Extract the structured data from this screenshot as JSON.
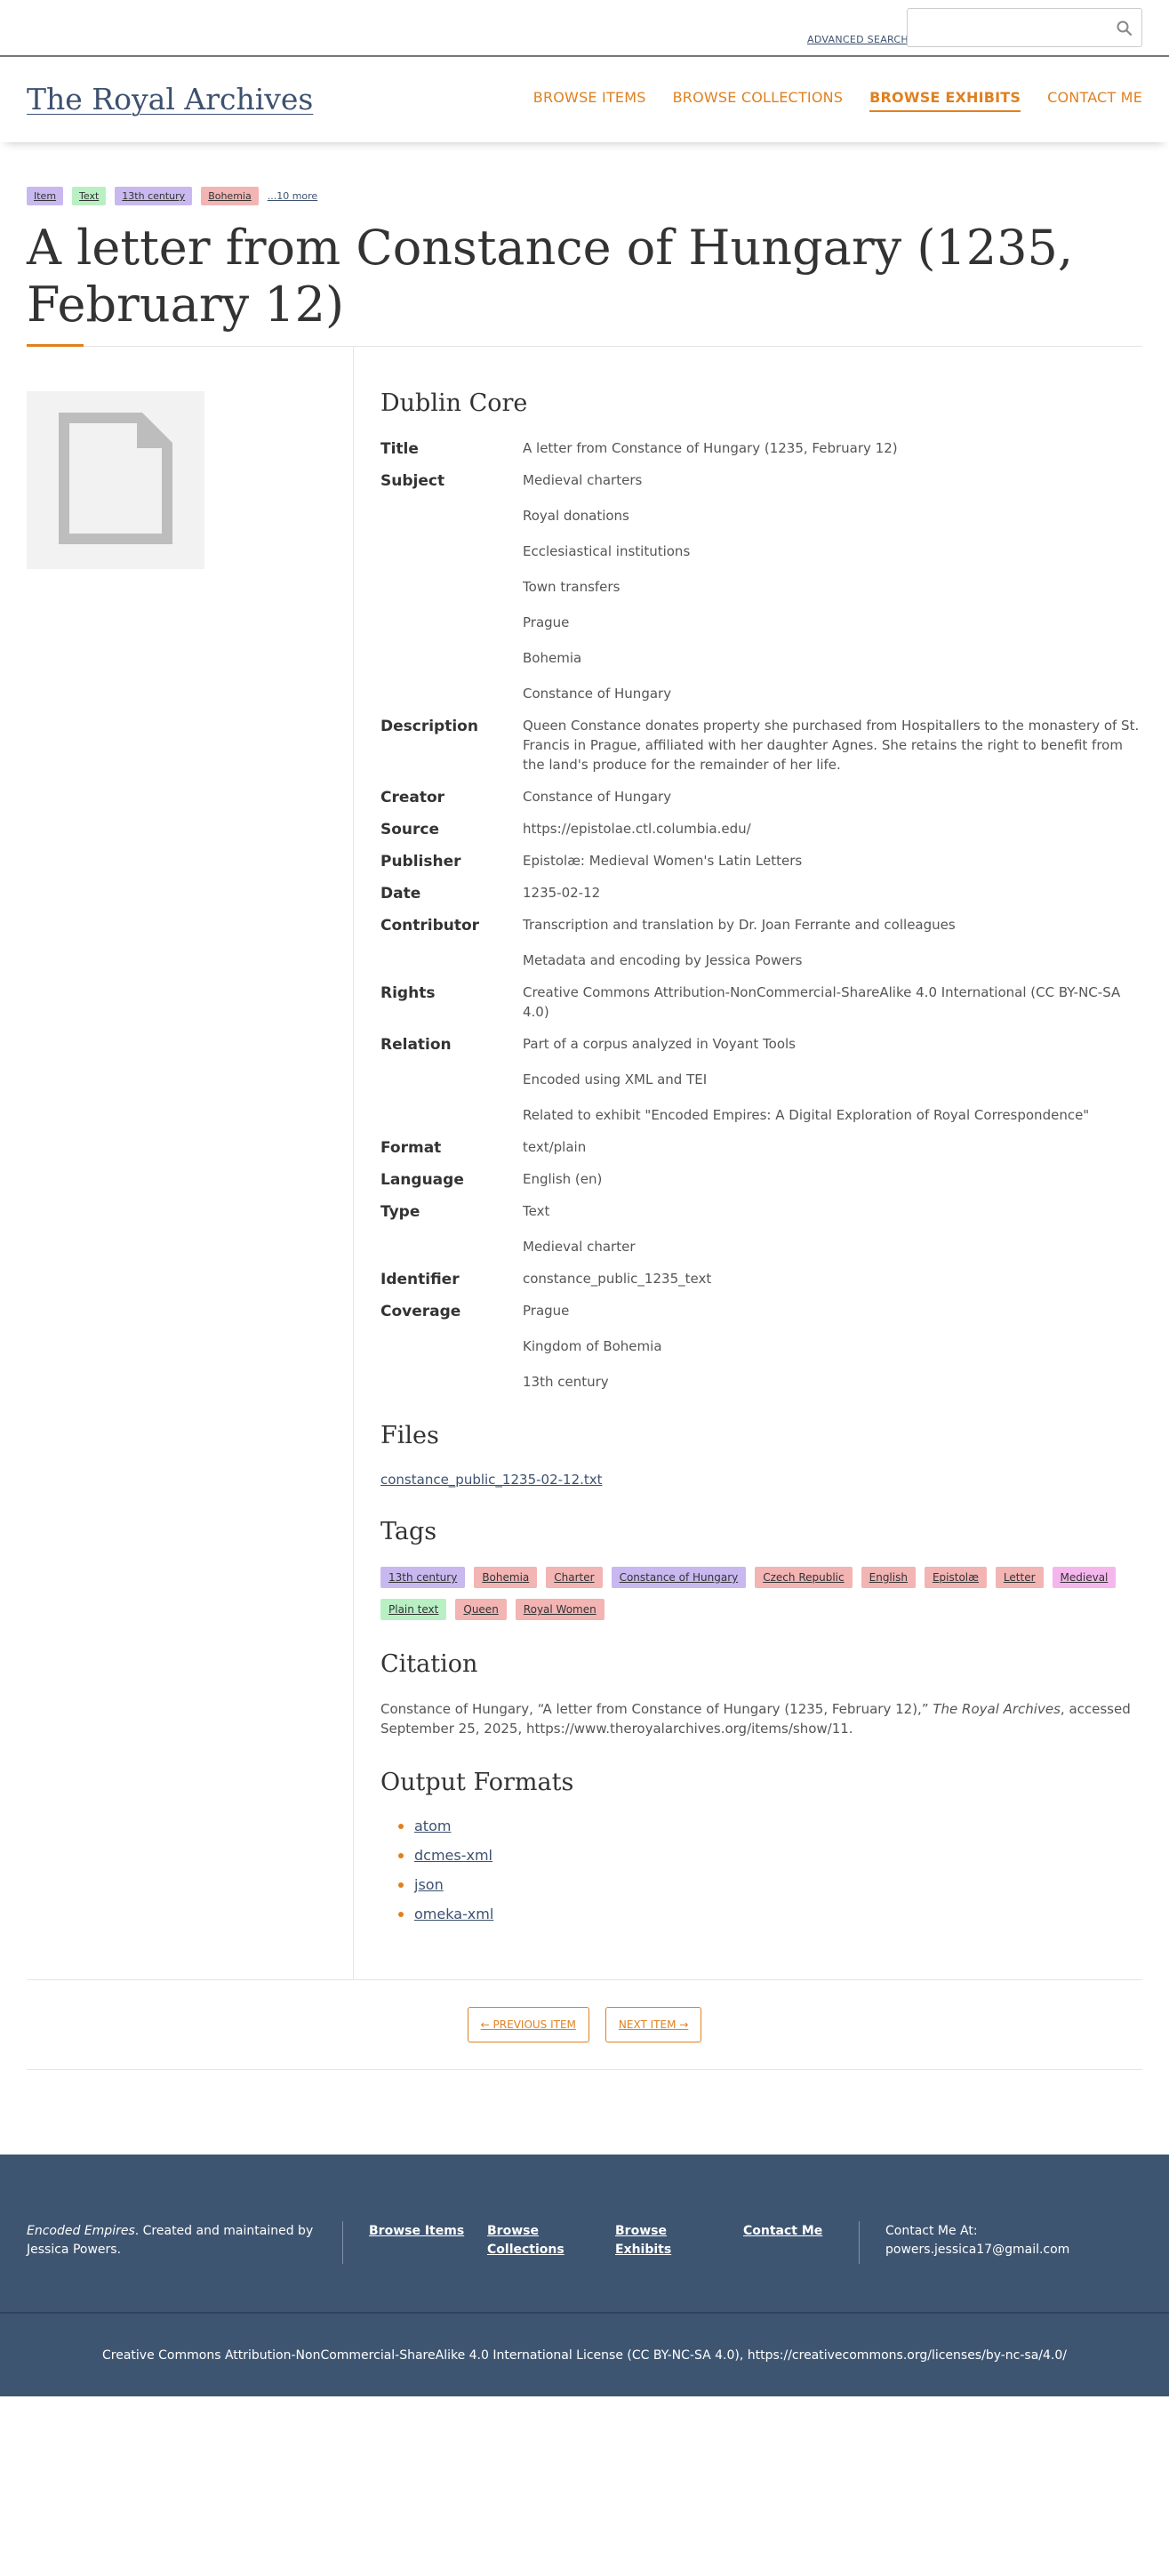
{
  "topbar": {
    "advanced_search": "ADVANCED SEARCH",
    "search_placeholder": ""
  },
  "header": {
    "site_title": "The Royal Archives",
    "nav": [
      {
        "label": "BROWSE ITEMS"
      },
      {
        "label": "BROWSE COLLECTIONS"
      },
      {
        "label": "BROWSE EXHIBITS"
      },
      {
        "label": "CONTACT ME"
      }
    ]
  },
  "item": {
    "top_tags": [
      {
        "label": "Item",
        "color": "#c9b8f0"
      },
      {
        "label": "Text",
        "color": "#b8f0c4"
      },
      {
        "label": "13th century",
        "color": "#c9b8f0"
      },
      {
        "label": "Bohemia",
        "color": "#f3b4b4"
      }
    ],
    "more_tags": "...10 more",
    "title": "A letter from Constance of Hungary (1235, February 12)"
  },
  "dublin_core": {
    "heading": "Dublin Core",
    "fields": [
      {
        "label": "Title",
        "values": [
          "A letter from Constance of Hungary (1235, February 12)"
        ]
      },
      {
        "label": "Subject",
        "values": [
          "Medieval charters",
          "Royal donations",
          "Ecclesiastical institutions",
          "Town transfers",
          "Prague",
          "Bohemia",
          "Constance of Hungary"
        ]
      },
      {
        "label": "Description",
        "values": [
          "Queen Constance donates property she purchased from Hospitallers to the monastery of St. Francis in Prague, affiliated with her daughter Agnes. She retains the right to benefit from the land's produce for the remainder of her life."
        ]
      },
      {
        "label": "Creator",
        "values": [
          "Constance of Hungary"
        ]
      },
      {
        "label": "Source",
        "values": [
          "https://epistolae.ctl.columbia.edu/"
        ]
      },
      {
        "label": "Publisher",
        "values": [
          "Epistolæ: Medieval Women's Latin Letters"
        ]
      },
      {
        "label": "Date",
        "values": [
          "1235-02-12"
        ]
      },
      {
        "label": "Contributor",
        "values": [
          "Transcription and translation by Dr. Joan Ferrante and colleagues",
          "Metadata and encoding by Jessica Powers"
        ]
      },
      {
        "label": "Rights",
        "values": [
          "Creative Commons Attribution-NonCommercial-ShareAlike 4.0 International (CC BY-NC-SA 4.0)"
        ]
      },
      {
        "label": "Relation",
        "values": [
          "Part of a corpus analyzed in Voyant Tools",
          "Encoded using XML and TEI",
          "Related to exhibit \"Encoded Empires: A Digital Exploration of Royal Correspondence\""
        ]
      },
      {
        "label": "Format",
        "values": [
          "text/plain"
        ]
      },
      {
        "label": "Language",
        "values": [
          "English (en)"
        ]
      },
      {
        "label": "Type",
        "values": [
          "Text",
          "Medieval charter"
        ]
      },
      {
        "label": "Identifier",
        "values": [
          "constance_public_1235_text"
        ]
      },
      {
        "label": "Coverage",
        "values": [
          "Prague",
          "Kingdom of Bohemia",
          "13th century"
        ]
      }
    ]
  },
  "files": {
    "heading": "Files",
    "items": [
      "constance_public_1235-02-12.txt"
    ]
  },
  "tags": {
    "heading": "Tags",
    "items": [
      {
        "label": "13th century",
        "color": "#c9b8f0"
      },
      {
        "label": "Bohemia",
        "color": "#f3b4b4"
      },
      {
        "label": "Charter",
        "color": "#f3b4b4"
      },
      {
        "label": "Constance of Hungary",
        "color": "#c9b8f0"
      },
      {
        "label": "Czech Republic",
        "color": "#f3b4b4"
      },
      {
        "label": "English",
        "color": "#f3b4b4"
      },
      {
        "label": "Epistolæ",
        "color": "#f3b4b4"
      },
      {
        "label": "Letter",
        "color": "#f3b4b4"
      },
      {
        "label": "Medieval",
        "color": "#f5b6ee"
      },
      {
        "label": "Plain text",
        "color": "#b8f0c4"
      },
      {
        "label": "Queen",
        "color": "#f3b4b4"
      },
      {
        "label": "Royal Women",
        "color": "#f3b4b4"
      }
    ]
  },
  "citation": {
    "heading": "Citation",
    "before": "Constance of Hungary, “A letter from Constance of Hungary (1235, February 12),” ",
    "site": "The Royal Archives",
    "after": ", accessed September 25, 2025, https://www.theroyalarchives.org/items/show/11."
  },
  "output_formats": {
    "heading": "Output Formats",
    "items": [
      "atom",
      "dcmes-xml",
      "json",
      "omeka-xml"
    ]
  },
  "pager": {
    "previous": "← PREVIOUS ITEM",
    "next": "NEXT ITEM →"
  },
  "footer": {
    "about_title": "Encoded Empires",
    "about_text": ". Created and maintained by Jessica Powers.",
    "links": [
      {
        "label": "Browse Items"
      },
      {
        "label": "Browse Collections"
      },
      {
        "label": "Browse Exhibits"
      },
      {
        "label": "Contact Me"
      }
    ],
    "contact_label": "Contact Me At:",
    "contact_email": "powers.jessica17@gmail.com",
    "license": "Creative Commons Attribution-NonCommercial-ShareAlike 4.0 International License (CC BY-NC-SA 4.0), https://creativecommons.org/licenses/by-nc-sa/4.0/"
  },
  "colors": {
    "accent": "#e0801f",
    "link": "#3d5170",
    "footer_bg": "#3e5571"
  },
  "icons": {
    "search": "search-icon",
    "file": "file-icon"
  }
}
